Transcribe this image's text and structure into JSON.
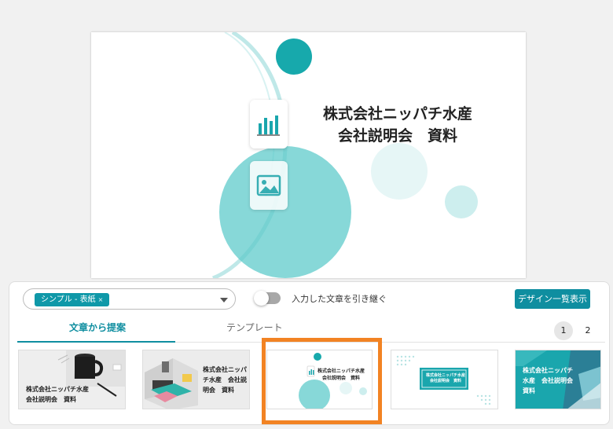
{
  "slide": {
    "title_line1": "株式会社ニッパチ水産",
    "title_line2": "会社説明会　資料"
  },
  "panel": {
    "design_select": {
      "chip_label": "シンプル - 表紙",
      "chip_remove": "×"
    },
    "toggle": {
      "label": "入力した文章を引き継ぐ",
      "on": false
    },
    "design_list_button": "デザイン一覧表示",
    "tabs": [
      {
        "label": "文章から提案",
        "active": true
      },
      {
        "label": "テンプレート",
        "active": false
      }
    ],
    "pagination": [
      "1",
      "2"
    ],
    "current_page": "1"
  },
  "thumbnails": [
    {
      "line1": "株式会社ニッパチ水産",
      "line2": "会社説明会　資料"
    },
    {
      "line1": "株式会社ニッパ",
      "line2": "チ水産　会社説",
      "line3": "明会　資料"
    },
    {
      "line1": "株式会社ニッパチ水産",
      "line2": "会社説明会　資料",
      "selected": true
    },
    {
      "line1": "株式会社ニッパチ水産",
      "line2": "会社説明会　資料"
    },
    {
      "line1": "株式会社ニッパチ",
      "line2": "水産　会社説明会",
      "line3": "資料"
    }
  ],
  "colors": {
    "accent": "#0f98a8",
    "teal_light": "#7fd6d6",
    "selection": "#f28323"
  }
}
